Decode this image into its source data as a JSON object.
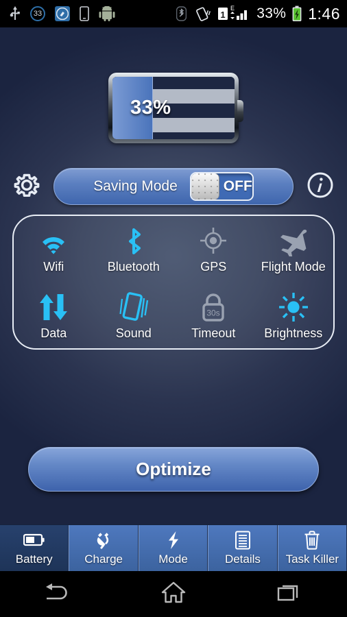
{
  "statusbar": {
    "left_icons": [
      {
        "name": "usb-icon",
        "label": "USB"
      },
      {
        "name": "notification-badge-33",
        "label": "33"
      },
      {
        "name": "cleaner-app-icon",
        "label": "Cleaner"
      },
      {
        "name": "phone-icon",
        "label": "Phone"
      },
      {
        "name": "android-robot-icon",
        "label": "Android"
      }
    ],
    "right_icons": [
      {
        "name": "bluetooth-status-icon",
        "label": "Bluetooth"
      },
      {
        "name": "vibrate-icon",
        "label": "Vibrate"
      },
      {
        "name": "sim1-edge-signal-icon",
        "label": "1"
      },
      {
        "name": "edge-network-label",
        "label": "E"
      }
    ],
    "battery_percent": "33%",
    "time": "1:46"
  },
  "battery": {
    "percent_label": "33%",
    "level": 33
  },
  "saving_mode": {
    "label": "Saving Mode",
    "toggle_state": "OFF",
    "settings_icon": "gear-icon",
    "info_icon": "info-icon"
  },
  "toggles": [
    {
      "label": "Wifi",
      "icon": "wifi-icon",
      "active": true
    },
    {
      "label": "Bluetooth",
      "icon": "bluetooth-icon",
      "active": true
    },
    {
      "label": "GPS",
      "icon": "gps-icon",
      "active": false
    },
    {
      "label": "Flight Mode",
      "icon": "airplane-icon",
      "active": false
    },
    {
      "label": "Data",
      "icon": "data-arrows-icon",
      "active": true
    },
    {
      "label": "Sound",
      "icon": "vibrate-phone-icon",
      "active": true
    },
    {
      "label": "Timeout",
      "icon": "lock-icon",
      "active": false,
      "value": "30s"
    },
    {
      "label": "Brightness",
      "icon": "sun-icon",
      "active": true
    }
  ],
  "optimize_button": {
    "label": "Optimize"
  },
  "tabs": [
    {
      "label": "Battery",
      "icon": "battery-icon",
      "active": true
    },
    {
      "label": "Charge",
      "icon": "plug-icon",
      "active": false
    },
    {
      "label": "Mode",
      "icon": "lightning-icon",
      "active": false
    },
    {
      "label": "Details",
      "icon": "document-icon",
      "active": false
    },
    {
      "label": "Task Killer",
      "icon": "trash-icon",
      "active": false
    }
  ],
  "navbar": [
    {
      "name": "back-button",
      "icon": "back-icon"
    },
    {
      "name": "home-button",
      "icon": "home-icon"
    },
    {
      "name": "recents-button",
      "icon": "recents-icon"
    }
  ],
  "colors": {
    "accent_cyan": "#29c0f5",
    "inactive_gray": "#9aa2b1",
    "tab_blue": "#4a73b7",
    "tab_active": "#243c64",
    "fill_blue": "#5a80c4"
  }
}
